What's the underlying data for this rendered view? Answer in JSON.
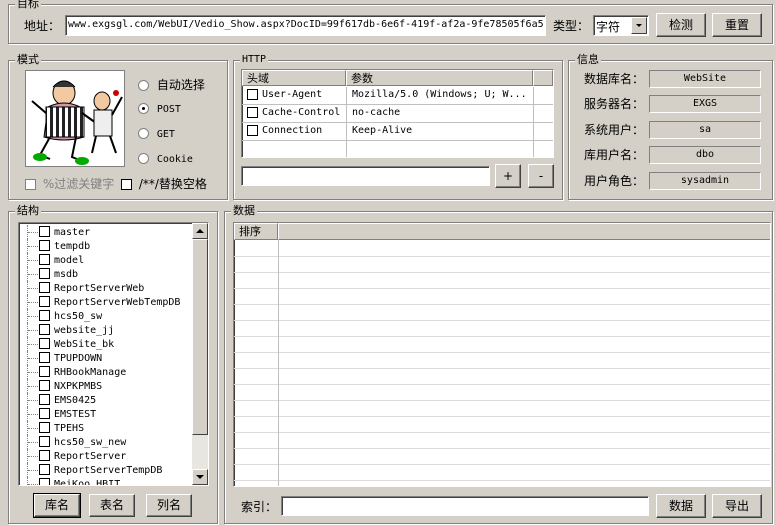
{
  "target": {
    "title": "目标",
    "address_label": "地址：",
    "address_value": "www.exgsgl.com/WebUI/Vedio_Show.aspx?DocID=99f617db-6e6f-419f-af2a-9fe78505f6a5",
    "type_label": "类型：",
    "type_value": "字符",
    "detect_button": "检测",
    "reset_button": "重置"
  },
  "mode": {
    "title": "模式",
    "radios": [
      "自动选择",
      "POST",
      "GET",
      "Cookie"
    ],
    "selected": "POST",
    "filter_keyword": "%过滤关键字",
    "replace_space": "/**/替换空格"
  },
  "http": {
    "title": "HTTP",
    "col_header": "头域",
    "col_param": "参数",
    "rows": [
      {
        "header": "User-Agent",
        "param": "Mozilla/5.0 (Windows; U; W..."
      },
      {
        "header": "Cache-Control",
        "param": "no-cache"
      },
      {
        "header": "Connection",
        "param": "Keep-Alive"
      }
    ],
    "add_button": "+",
    "remove_button": "-"
  },
  "info": {
    "title": "信息",
    "rows": [
      {
        "label": "数据库名：",
        "value": "WebSite"
      },
      {
        "label": "服务器名：",
        "value": "EXGS"
      },
      {
        "label": "系统用户：",
        "value": "sa"
      },
      {
        "label": "库用户名：",
        "value": "dbo"
      },
      {
        "label": "用户角色：",
        "value": "sysadmin"
      }
    ]
  },
  "structure": {
    "title": "结构",
    "items": [
      "master",
      "tempdb",
      "model",
      "msdb",
      "ReportServerWeb",
      "ReportServerWebTempDB",
      "hcs50_sw",
      "website_jj",
      "WebSite_bk",
      "TPUPDOWN",
      "RHBookManage",
      "NXPKPMBS",
      "EMS0425",
      "EMSTEST",
      "TPEHS",
      "hcs50_sw_new",
      "ReportServer",
      "ReportServerTempDB",
      "MeiKoo_HBIT"
    ],
    "db_button": "库名",
    "table_button": "表名",
    "column_button": "列名"
  },
  "data": {
    "title": "数据",
    "col_sort": "排序",
    "index_label": "索引：",
    "data_button": "数据",
    "export_button": "导出"
  },
  "colors": {
    "face": "#d4d0c8",
    "shadow": "#808080",
    "highlight": "#ffffff"
  }
}
